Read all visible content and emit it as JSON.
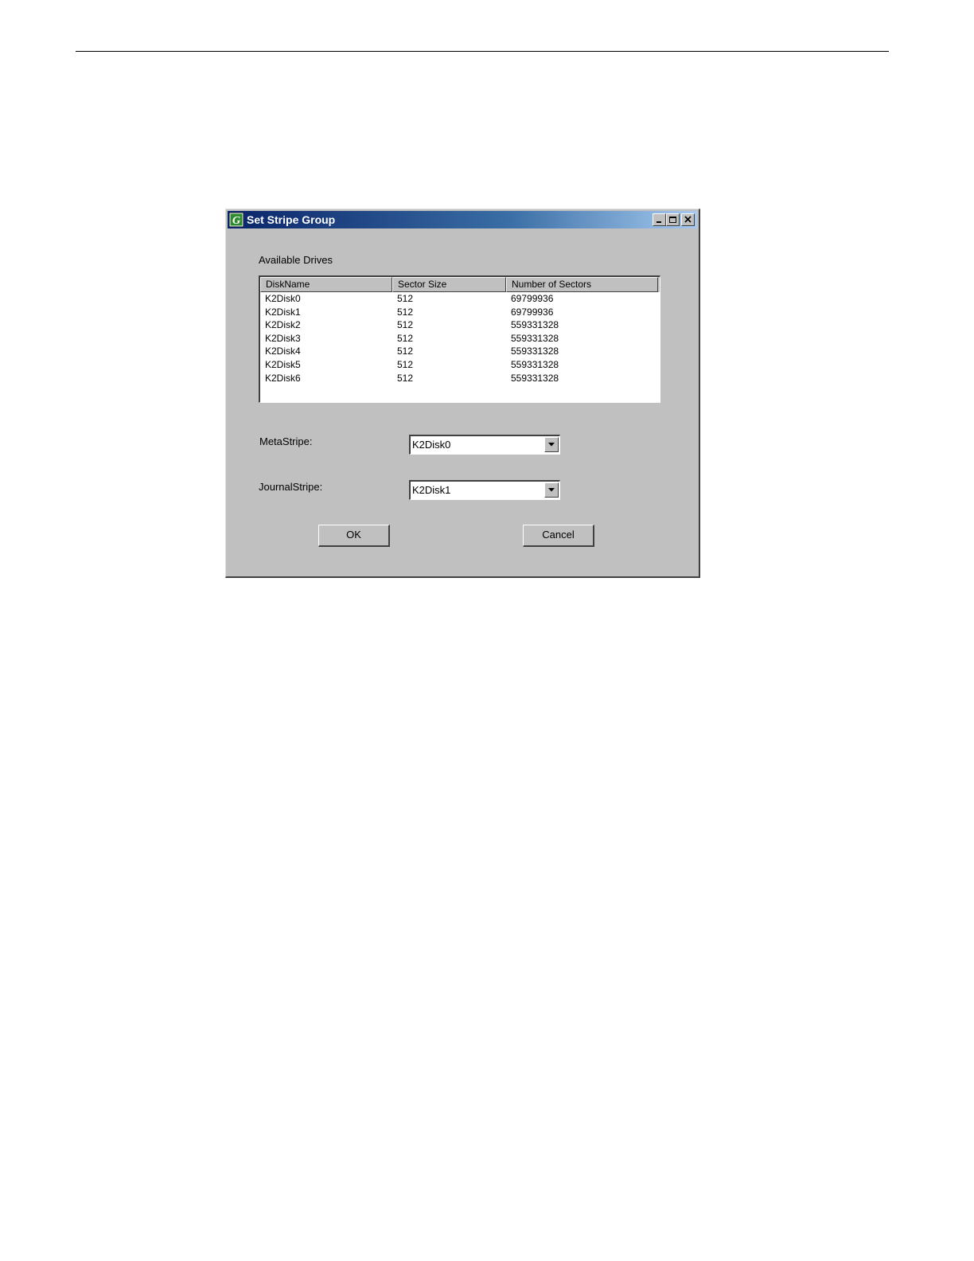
{
  "window": {
    "title": "Set Stripe Group"
  },
  "available_drives": {
    "label": "Available Drives",
    "columns": [
      "DiskName",
      "Sector Size",
      "Number of Sectors"
    ],
    "rows": [
      [
        "K2Disk0",
        "512",
        "69799936"
      ],
      [
        "K2Disk1",
        "512",
        "69799936"
      ],
      [
        "K2Disk2",
        "512",
        "559331328"
      ],
      [
        "K2Disk3",
        "512",
        "559331328"
      ],
      [
        "K2Disk4",
        "512",
        "559331328"
      ],
      [
        "K2Disk5",
        "512",
        "559331328"
      ],
      [
        "K2Disk6",
        "512",
        "559331328"
      ]
    ]
  },
  "meta_stripe": {
    "label": "MetaStripe:",
    "value": "K2Disk0"
  },
  "journal_stripe": {
    "label": "JournalStripe:",
    "value": "K2Disk1"
  },
  "buttons": {
    "ok_label": "OK",
    "cancel_label": "Cancel"
  },
  "icons": {
    "app": "grass-valley-logo-icon",
    "minimize": "minimize-icon",
    "maximize": "maximize-icon",
    "close": "close-icon",
    "dropdown": "chevron-down-icon"
  },
  "colors": {
    "titlebar_start": "#0a246a",
    "titlebar_end": "#a6caf0",
    "dialog_face": "#c0c0c0",
    "app_icon_green": "#2e8b2e"
  }
}
